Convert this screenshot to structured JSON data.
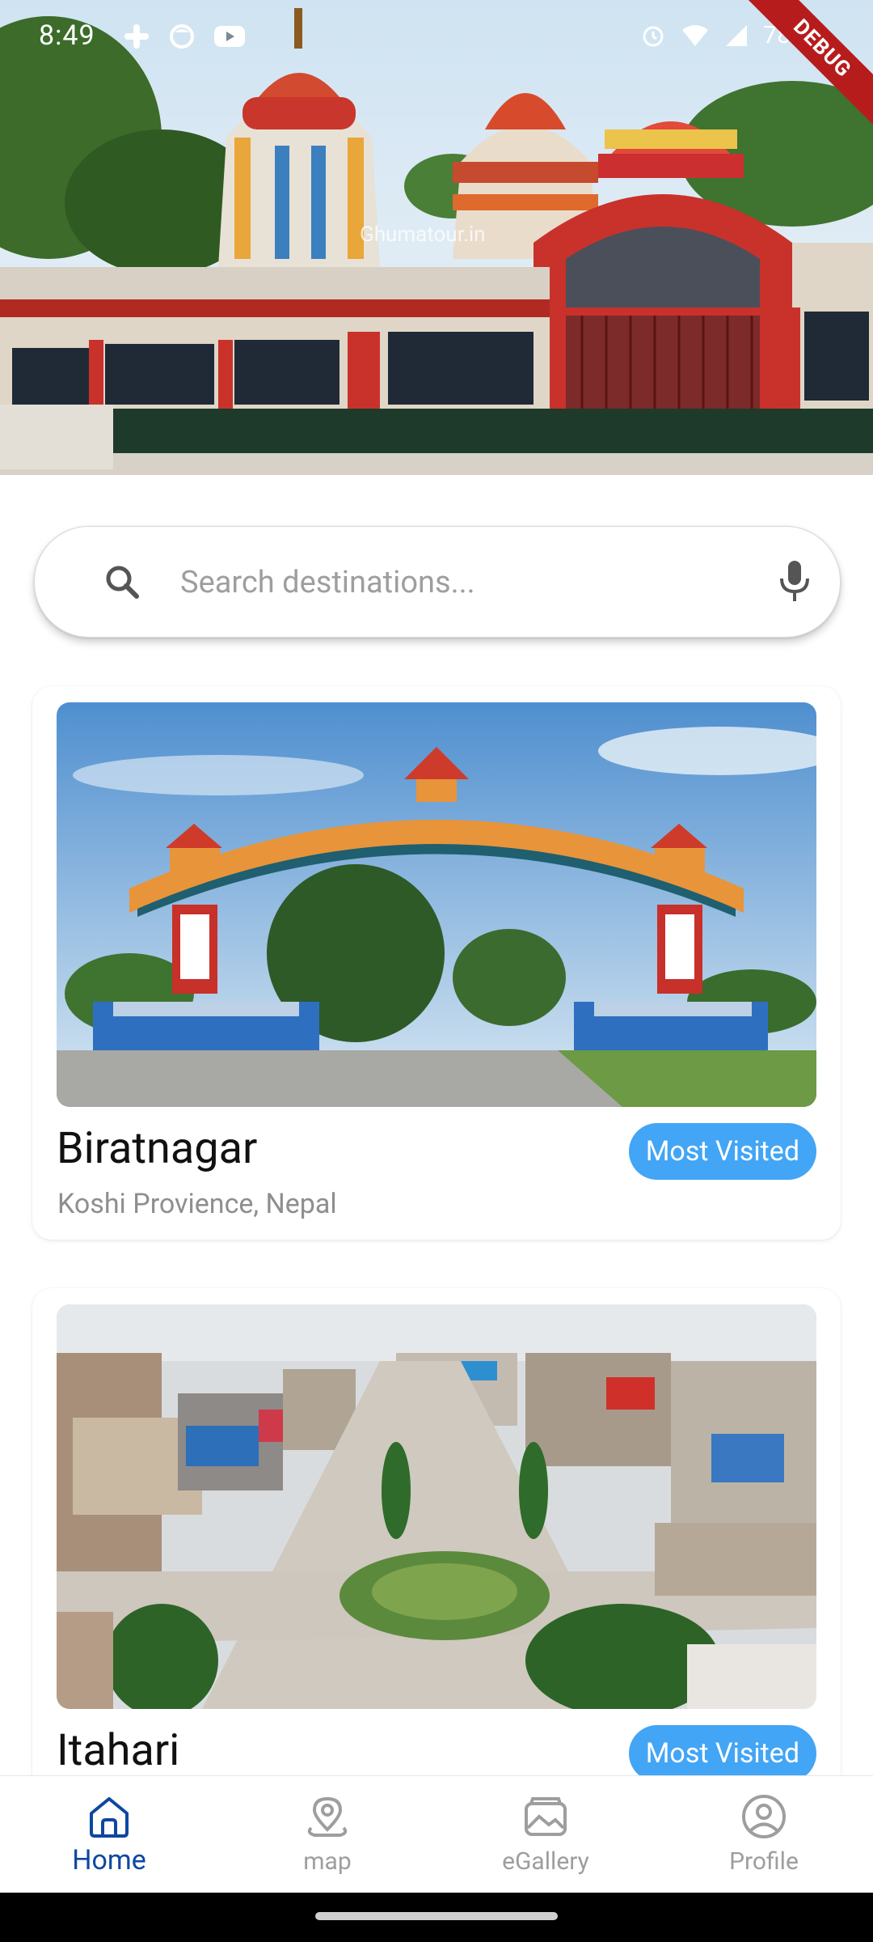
{
  "status_bar": {
    "time": "8:49",
    "battery": "78%",
    "debug_label": "DEBUG",
    "left_icons": [
      "slack-icon",
      "circle-app-icon",
      "youtube-icon"
    ],
    "right_icons": [
      "alarm-icon",
      "wifi-icon",
      "signal-icon",
      "battery-icon"
    ]
  },
  "hero": {
    "image": "temple-photo",
    "watermark": "Ghumatour.in"
  },
  "search": {
    "placeholder": "Search destinations...",
    "value": "",
    "left_icon": "search-icon",
    "right_icon": "mic-icon"
  },
  "destinations": [
    {
      "name": "Biratnagar",
      "location": "Koshi Provience, Nepal",
      "badge": "Most Visited",
      "image": "welcome-arch-photo"
    },
    {
      "name": "Itahari",
      "location": "",
      "badge": "Most Visited",
      "image": "city-aerial-photo"
    }
  ],
  "bottom_nav": {
    "items": [
      {
        "label": "Home",
        "icon": "home-icon",
        "active": true
      },
      {
        "label": "map",
        "icon": "map-pin-icon",
        "active": false
      },
      {
        "label": "eGallery",
        "icon": "gallery-icon",
        "active": false
      },
      {
        "label": "Profile",
        "icon": "profile-icon",
        "active": false
      }
    ]
  },
  "colors": {
    "accent": "#42a5f5",
    "nav_active": "#0d47a1",
    "nav_inactive": "#9e9e9e",
    "debug_ribbon": "#b71c1c"
  }
}
